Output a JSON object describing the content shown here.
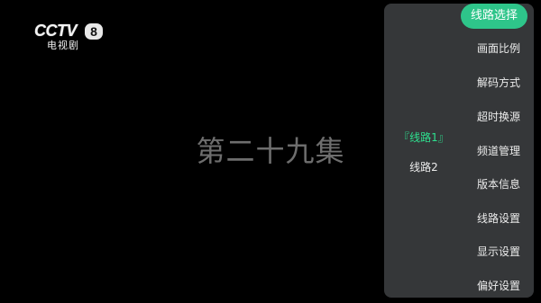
{
  "channel_logo": {
    "brand": "CCTV",
    "number": "8",
    "subtitle": "电视剧"
  },
  "video": {
    "episode_title": "第二十九集"
  },
  "menu": {
    "items": [
      {
        "label": "线路选择",
        "active": true
      },
      {
        "label": "画面比例"
      },
      {
        "label": "解码方式"
      },
      {
        "label": "超时换源"
      },
      {
        "label": "频道管理"
      },
      {
        "label": "版本信息"
      },
      {
        "label": "线路设置"
      },
      {
        "label": "显示设置"
      },
      {
        "label": "偏好设置"
      }
    ],
    "active_color": "#2ec58a"
  },
  "line_options": {
    "items": [
      {
        "label": "『线路1』",
        "selected": true
      },
      {
        "label": "线路2"
      }
    ],
    "selected_color": "#2ee08f"
  }
}
